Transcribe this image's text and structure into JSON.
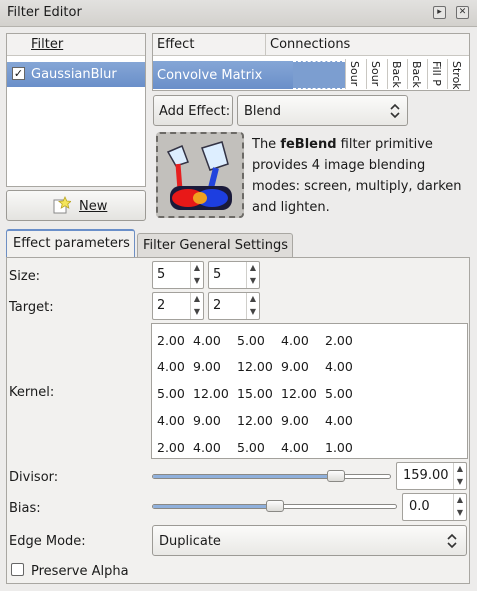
{
  "window": {
    "title": "Filter Editor",
    "restore_glyph": "▸",
    "close_glyph": "✕"
  },
  "filter_list": {
    "header": "Filter",
    "items": [
      {
        "label": "GaussianBlur",
        "checked": true
      }
    ],
    "new_button": "New"
  },
  "effect_list": {
    "header_effect": "Effect",
    "header_connections": "Connections",
    "selected": "Convolve Matrix",
    "input_headers": [
      "Sour",
      "Sour",
      "Back",
      "Back",
      "Fill P",
      "Strok"
    ]
  },
  "add_effect": {
    "button_label": "Add Effect:",
    "selected": "Blend"
  },
  "description": {
    "prefix": "The ",
    "name": "feBlend",
    "suffix": " filter primitive provides 4 image blending modes: screen, multiply, darken and lighten."
  },
  "tabs": {
    "active": "Effect parameters",
    "inactive": "Filter General Settings"
  },
  "params": {
    "size": {
      "label": "Size:",
      "x": "5",
      "y": "5"
    },
    "target": {
      "label": "Target:",
      "x": "2",
      "y": "2"
    },
    "kernel": {
      "label": "Kernel:",
      "rows": [
        [
          "2.00",
          "4.00",
          "5.00",
          "4.00",
          "2.00"
        ],
        [
          "4.00",
          "9.00",
          "12.00",
          "9.00",
          "4.00"
        ],
        [
          "5.00",
          "12.00",
          "15.00",
          "12.00",
          "5.00"
        ],
        [
          "4.00",
          "9.00",
          "12.00",
          "9.00",
          "4.00"
        ],
        [
          "2.00",
          "4.00",
          "5.00",
          "4.00",
          "1.00"
        ]
      ]
    },
    "divisor": {
      "label": "Divisor:",
      "value": "159.00",
      "slider_fraction": 0.77
    },
    "bias": {
      "label": "Bias:",
      "value": "0.0",
      "slider_fraction": 0.5
    },
    "edge_mode": {
      "label": "Edge Mode:",
      "value": "Duplicate"
    },
    "preserve_alpha": {
      "label": "Preserve Alpha",
      "checked": false
    }
  },
  "colors": {
    "selection": "#6a8fc9",
    "slider_fill": "#8fb0dc"
  },
  "icons": {
    "checkbox": "check-icon",
    "new": "star-icon",
    "effect": "feblend-paint-icon",
    "spin": "arrow-icon",
    "combo": "updown-chevron-icon"
  }
}
